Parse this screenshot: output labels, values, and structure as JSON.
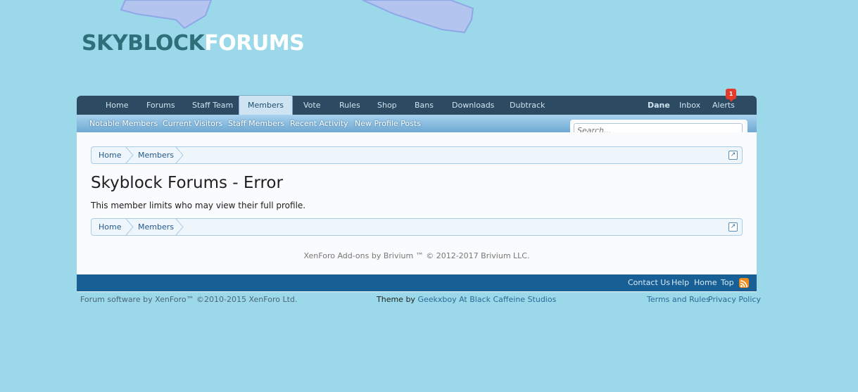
{
  "logo": {
    "part1": "SKYBLOCK",
    "part2": "FORUMS"
  },
  "nav": {
    "tabs": [
      "Home",
      "Forums",
      "Staff Team",
      "Members",
      "Vote",
      "Rules",
      "Shop",
      "Bans",
      "Downloads",
      "Dubtrack"
    ],
    "active_tab": "Members",
    "user": "Dane",
    "inbox": "Inbox",
    "alerts": "Alerts",
    "alerts_count": "1"
  },
  "subnav": {
    "links": [
      "Notable Members",
      "Current Visitors",
      "Staff Members",
      "Recent Activity",
      "New Profile Posts"
    ]
  },
  "search": {
    "placeholder": "Search..."
  },
  "breadcrumb": [
    "Home",
    "Members"
  ],
  "page": {
    "title": "Skyblock Forums - Error",
    "message": "This member limits who may view their full profile.",
    "addon_copyright": "XenForo Add-ons by Brivium ™ © 2012-2017 Brivium LLC."
  },
  "footer": {
    "links": [
      "Contact Us",
      "Help",
      "Home",
      "Top"
    ],
    "software": "Forum software by XenForo™ ©2010-2015 XenForo Ltd.",
    "theme_label": "Theme by",
    "theme_author": "Geekxboy At Black Caffeine Studios",
    "terms": "Terms and Rules",
    "privacy": "Privacy Policy"
  },
  "colors": {
    "background": "#9bd9ea",
    "navbar": "#2c4a61",
    "footer": "#185f95",
    "alert_badge": "#e23b2e"
  }
}
